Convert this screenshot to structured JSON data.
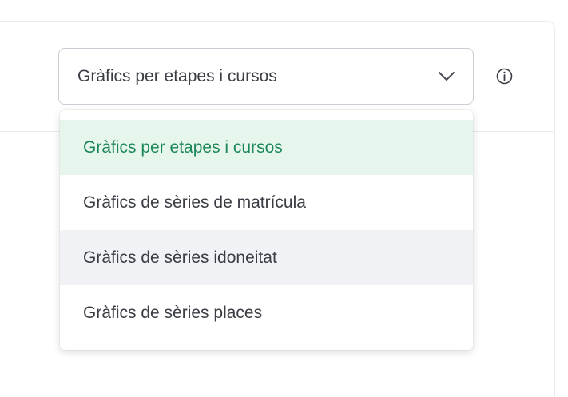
{
  "select": {
    "value": "Gràfics per etapes i cursos",
    "icon": "chevron-down-icon"
  },
  "info": {
    "icon": "info-icon"
  },
  "dropdown": {
    "options": [
      {
        "label": "Gràfics per etapes i cursos",
        "state": "selected"
      },
      {
        "label": "Gràfics de sèries de matrícula",
        "state": "normal"
      },
      {
        "label": "Gràfics de sèries idoneitat",
        "state": "hovered"
      },
      {
        "label": "Gràfics de sèries places",
        "state": "normal"
      }
    ]
  },
  "colors": {
    "selected_bg": "#e7f6ec",
    "selected_text": "#1c8758",
    "hover_bg": "#f1f2f5",
    "text": "#3a3d44",
    "border": "#c9cdd4"
  }
}
